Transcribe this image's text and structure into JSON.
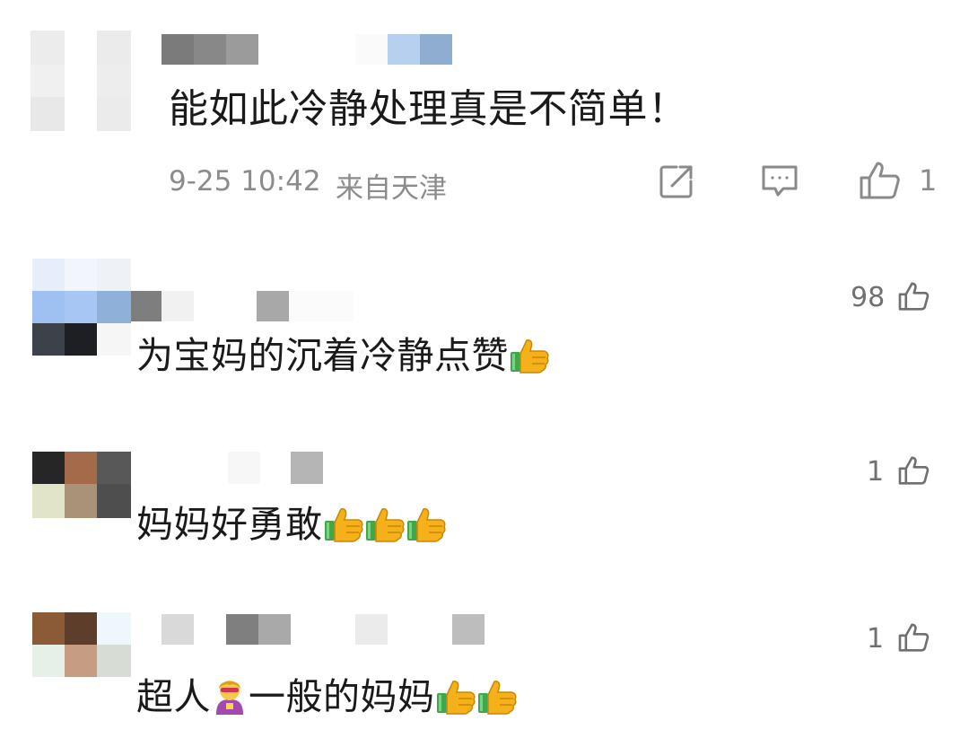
{
  "main_comment": {
    "text": "能如此冷静处理真是不简单！",
    "timestamp": "9-25 10:42",
    "location": "来自天津",
    "like_count": "1",
    "icons": [
      "share-icon",
      "comment-icon",
      "thumbs-up-icon"
    ]
  },
  "replies": [
    {
      "text": "为宝妈的沉着冷静点赞",
      "emojis": [
        "thumbs-up-emoji"
      ],
      "like_count": "98"
    },
    {
      "text": "妈妈好勇敢",
      "emojis": [
        "thumbs-up-emoji",
        "thumbs-up-emoji",
        "thumbs-up-emoji"
      ],
      "like_count": "1"
    },
    {
      "text_before": "超人",
      "text_after": "一般的妈妈",
      "emojis": [
        "superhero-emoji",
        "thumbs-up-emoji",
        "thumbs-up-emoji"
      ],
      "like_count": "1"
    }
  ],
  "colors": {
    "text": "#1a1a1a",
    "meta": "#8c8c8c",
    "icon": "#8a8a8a",
    "emoji_yellow": "#f6b01a",
    "emoji_green": "#3ea94a"
  }
}
